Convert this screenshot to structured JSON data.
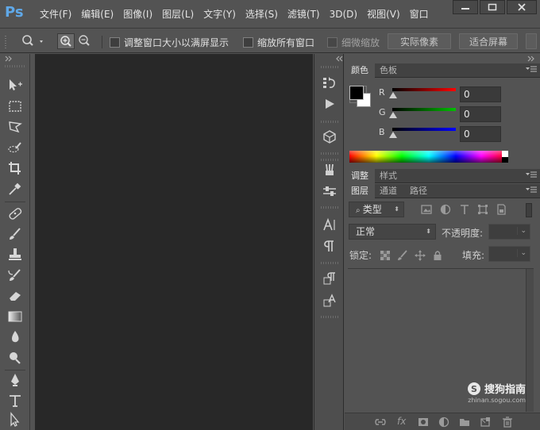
{
  "app": {
    "logo": "Ps"
  },
  "menubar": {
    "items": [
      "文件(F)",
      "编辑(E)",
      "图像(I)",
      "图层(L)",
      "文字(Y)",
      "选择(S)",
      "滤镜(T)",
      "3D(D)",
      "视图(V)",
      "窗口"
    ]
  },
  "options_bar": {
    "resize_windows_label": "调整窗口大小以满屏显示",
    "zoom_all_label": "缩放所有窗口",
    "scrubby_zoom_label": "细微缩放",
    "actual_pixels_label": "实际像素",
    "fit_screen_label": "适合屏幕"
  },
  "color_panel": {
    "tabs": [
      "颜色",
      "色板"
    ],
    "channels": [
      {
        "label": "R",
        "value": "0",
        "color": "#ff0000"
      },
      {
        "label": "G",
        "value": "0",
        "color": "#00c000"
      },
      {
        "label": "B",
        "value": "0",
        "color": "#0000ff"
      }
    ],
    "foreground": "#000000",
    "background": "#ffffff"
  },
  "adjust_panel": {
    "tabs": [
      "调整",
      "样式"
    ]
  },
  "layers_panel": {
    "tabs": [
      "图层",
      "通道",
      "路径"
    ],
    "filter_label": "类型",
    "blend_mode": "正常",
    "opacity_label": "不透明度:",
    "lock_label": "锁定:",
    "fill_label": "填充:"
  },
  "watermark": {
    "brand": "搜狗指南",
    "url": "zhinan.sogou.com"
  }
}
